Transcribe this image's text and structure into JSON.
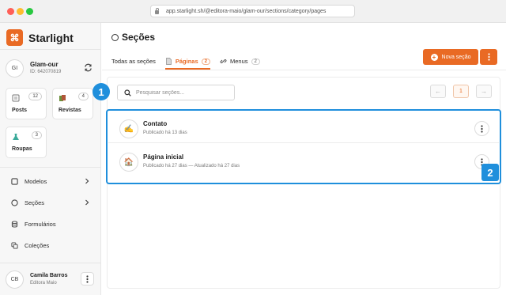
{
  "browser": {
    "url": "app.starlight.sh/@editora-maio/glam-our/sections/category/pages"
  },
  "brand": {
    "name": "Starlight",
    "logo_glyph": "⌘"
  },
  "account": {
    "initials": "GI",
    "name": "Glam-our",
    "id": "ID: 642070819"
  },
  "tiles": [
    {
      "label": "Posts",
      "count": "12",
      "icon": "posts-icon"
    },
    {
      "label": "Revistas",
      "count": "4",
      "icon": "magazine-icon"
    },
    {
      "label": "Roupas",
      "count": "3",
      "icon": "dress-icon"
    }
  ],
  "nav": [
    {
      "label": "Modelos",
      "icon": "square-icon",
      "chevron": true
    },
    {
      "label": "Seções",
      "icon": "circle-icon",
      "chevron": true
    },
    {
      "label": "Formulários",
      "icon": "database-icon",
      "chevron": false
    },
    {
      "label": "Coleções",
      "icon": "collections-icon",
      "chevron": false
    }
  ],
  "user": {
    "initials": "CB",
    "name": "Camila Barros",
    "org": "Editora Maio"
  },
  "page": {
    "title": "Seções"
  },
  "tabs": [
    {
      "label": "Todas as seções",
      "count": "",
      "active": false
    },
    {
      "label": "Páginas",
      "count": "2",
      "active": true
    },
    {
      "label": "Menus",
      "count": "2",
      "active": false
    }
  ],
  "actions": {
    "new_section": "Nova seção"
  },
  "search": {
    "placeholder": "Pesquisar seções..."
  },
  "pager": {
    "prev": "←",
    "current": "1",
    "next": "→"
  },
  "rows": [
    {
      "title": "Contato",
      "subtitle": "Publicado há 13 dias",
      "emoji": "✍️"
    },
    {
      "title": "Página inicial",
      "subtitle": "Publicado há 27 dias — Atualizado há 27 dias",
      "emoji": "🏠"
    }
  ],
  "markers": {
    "one": "1",
    "two": "2"
  },
  "colors": {
    "accent": "#e96a24",
    "highlight": "#1f8fdc"
  }
}
